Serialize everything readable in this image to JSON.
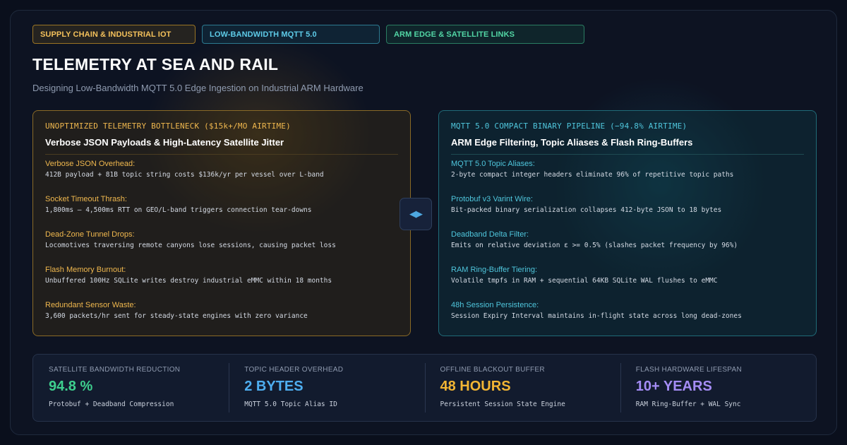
{
  "tags": [
    "SUPPLY CHAIN & INDUSTRIAL IOT",
    "LOW-BANDWIDTH MQTT 5.0",
    "ARM EDGE & SATELLITE LINKS"
  ],
  "title": "TELEMETRY AT SEA AND RAIL",
  "subtitle": "Designing Low-Bandwidth MQTT 5.0 Edge Ingestion on Industrial ARM Hardware",
  "left_panel": {
    "kicker": "UNOPTIMIZED TELEMETRY BOTTLENECK ($15k+/MO AIRTIME)",
    "heading": "Verbose JSON Payloads & High-Latency Satellite Jitter",
    "items": [
      {
        "label": "Verbose JSON Overhead:",
        "desc": "412B payload + 81B topic string costs $136k/yr per vessel over L-band"
      },
      {
        "label": "Socket Timeout Thrash:",
        "desc": "1,800ms – 4,500ms RTT on GEO/L-band triggers connection tear-downs"
      },
      {
        "label": "Dead-Zone Tunnel Drops:",
        "desc": "Locomotives traversing remote canyons lose sessions, causing packet loss"
      },
      {
        "label": "Flash Memory Burnout:",
        "desc": "Unbuffered 100Hz SQLite writes destroy industrial eMMC within 18 months"
      },
      {
        "label": "Redundant Sensor Waste:",
        "desc": "3,600 packets/hr sent for steady-state engines with zero variance"
      }
    ]
  },
  "swap_icon": "◀▶",
  "right_panel": {
    "kicker": "MQTT 5.0 COMPACT BINARY PIPELINE (−94.8% AIRTIME)",
    "heading": "ARM Edge Filtering, Topic Aliases & Flash Ring-Buffers",
    "items": [
      {
        "label": "MQTT 5.0 Topic Aliases:",
        "desc": "2-byte compact integer headers eliminate 96% of repetitive topic paths"
      },
      {
        "label": "Protobuf v3 Varint Wire:",
        "desc": "Bit-packed binary serialization collapses 412-byte JSON to 18 bytes"
      },
      {
        "label": "Deadband Delta Filter:",
        "desc": "Emits on relative deviation ε >= 0.5% (slashes packet frequency by 96%)"
      },
      {
        "label": "RAM Ring-Buffer Tiering:",
        "desc": "Volatile tmpfs in RAM + sequential 64KB SQLite WAL flushes to eMMC"
      },
      {
        "label": "48h Session Persistence:",
        "desc": "Session Expiry Interval maintains in-flight state across long dead-zones"
      }
    ]
  },
  "stats": [
    {
      "label": "SATELLITE BANDWIDTH REDUCTION",
      "value": "94.8 %",
      "sub": "Protobuf + Deadband Compression",
      "color": "#3ecf8e"
    },
    {
      "label": "TOPIC HEADER OVERHEAD",
      "value": "2 BYTES",
      "sub": "MQTT 5.0 Topic Alias ID",
      "color": "#4eaef0"
    },
    {
      "label": "OFFLINE BLACKOUT BUFFER",
      "value": "48 HOURS",
      "sub": "Persistent Session State Engine",
      "color": "#f2b534"
    },
    {
      "label": "FLASH HARDWARE LIFESPAN",
      "value": "10+ YEARS",
      "sub": "RAM Ring-Buffer + WAL Sync",
      "color": "#a48cf5"
    }
  ]
}
